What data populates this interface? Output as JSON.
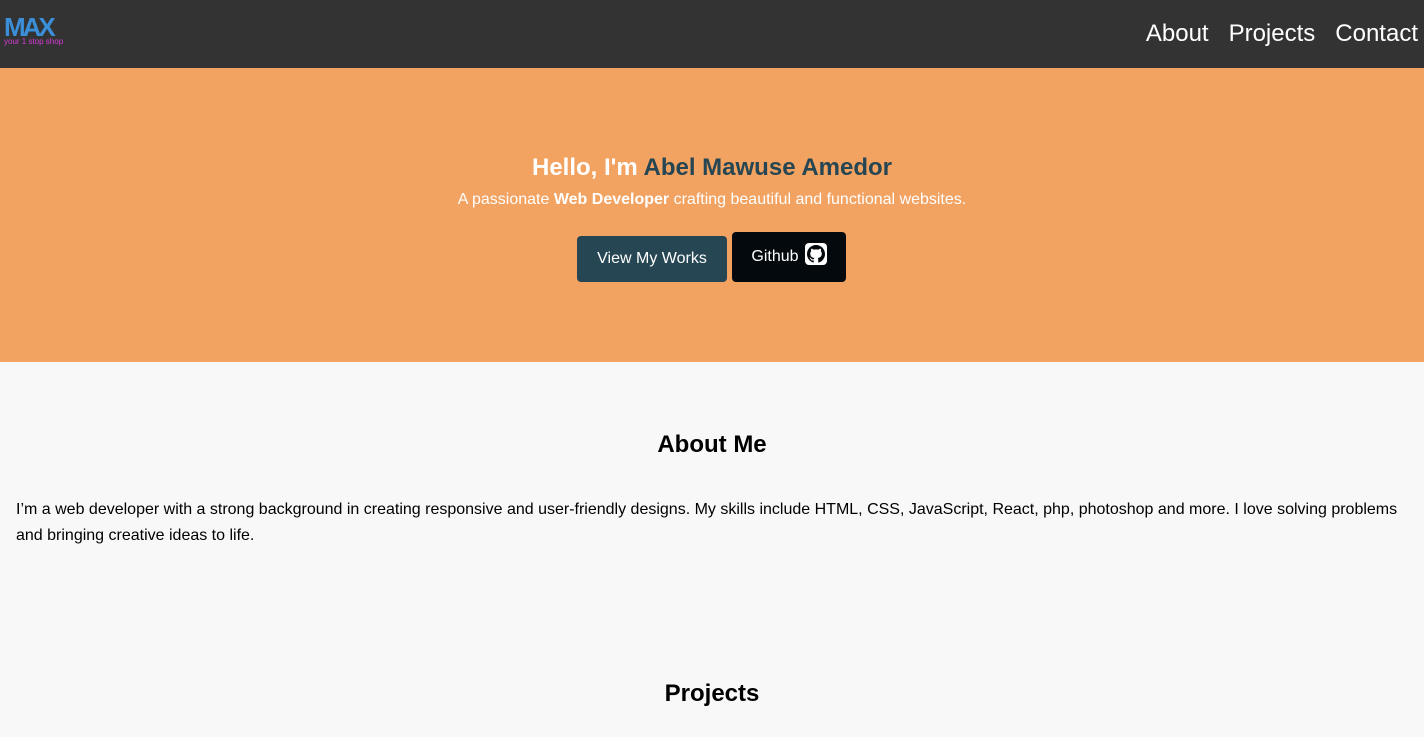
{
  "logo": {
    "word": "MAX",
    "tagline": "your 1 stop shop",
    "color": "#3a8fd8",
    "tagline_color": "#d63ad8"
  },
  "nav": {
    "links": [
      "About",
      "Projects",
      "Contact"
    ],
    "background": "#333333"
  },
  "hero": {
    "greeting": "Hello, I'm",
    "name": "Abel Mawuse Amedor",
    "subtitle_prefix": "A passionate",
    "subtitle_role": "Web Developer",
    "subtitle_suffix": "crafting beautiful and functional websites.",
    "primary_button": "View My Works",
    "secondary_button": "Github",
    "secondary_icon": "github-icon",
    "background": "#f2a261"
  },
  "about": {
    "title": "About Me",
    "text": "I’m a web developer with a strong background in creating responsive and user-friendly designs. My skills include HTML, CSS, JavaScript, React, php, photoshop and more. I love solving problems and bringing creative ideas to life."
  },
  "projects": {
    "title": "Projects"
  }
}
